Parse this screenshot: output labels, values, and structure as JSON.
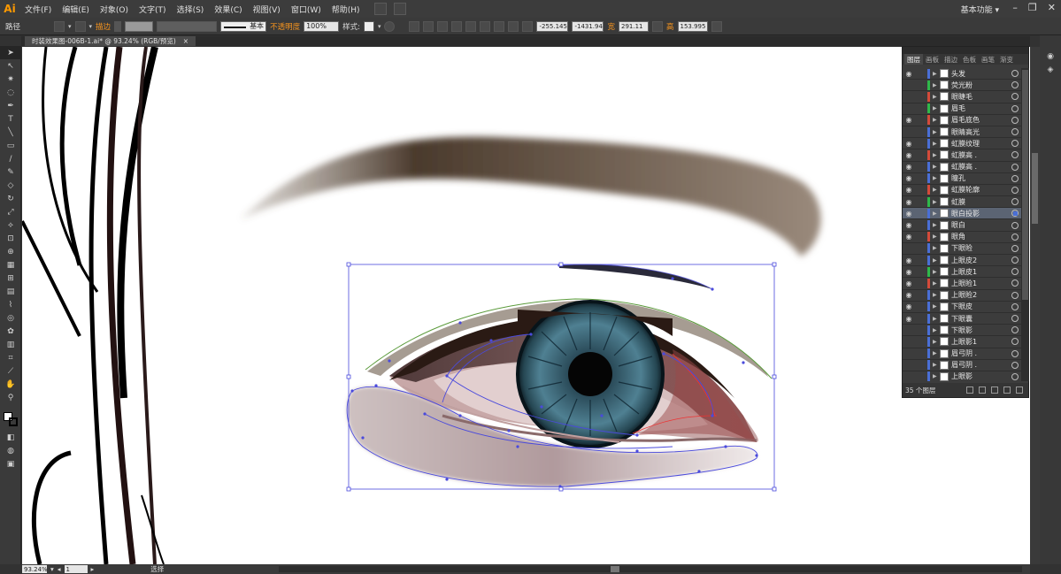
{
  "app": {
    "logo": "Ai",
    "workspace": "基本功能 ▾"
  },
  "menu": [
    "文件(F)",
    "编辑(E)",
    "对象(O)",
    "文字(T)",
    "选择(S)",
    "效果(C)",
    "视图(V)",
    "窗口(W)",
    "帮助(H)"
  ],
  "controlbar": {
    "path_label": "路径",
    "stroke_label": "描边",
    "brush_label": "基本",
    "opacity_label": "不透明度",
    "opacity_value": "100%",
    "style_label": "样式:",
    "x_value": "-255.145",
    "y_value": "-1431.94",
    "w_label": "宽",
    "w_value": "291.11",
    "h_label": "高",
    "h_value": "153.995"
  },
  "document": {
    "tab_title": "时装效果图-006B-1.ai* @ 93.24% (RGB/预览)",
    "close": "×"
  },
  "status": {
    "zoom": "93.24%",
    "page": "1",
    "mode": "选择"
  },
  "layers_panel": {
    "tabs": [
      "图层",
      "画板",
      "描边",
      "色板",
      "画笔",
      "渐变"
    ],
    "count_label": "35 个图层",
    "layers": [
      {
        "name": "头发",
        "eye": true,
        "color": "#4a6fd6"
      },
      {
        "name": "荧光粉",
        "eye": false,
        "color": "#2fb84a"
      },
      {
        "name": "眼睫毛",
        "eye": false,
        "color": "#d44a3a"
      },
      {
        "name": "眉毛",
        "eye": false,
        "color": "#2fb84a"
      },
      {
        "name": "眉毛底色",
        "eye": true,
        "color": "#d44a3a"
      },
      {
        "name": "眼睛高光",
        "eye": false,
        "color": "#4a6fd6"
      },
      {
        "name": "虹膜纹理",
        "eye": true,
        "color": "#4a6fd6"
      },
      {
        "name": "虹膜高 .",
        "eye": true,
        "color": "#d44a3a"
      },
      {
        "name": "虹膜高 .",
        "eye": true,
        "color": "#4a6fd6"
      },
      {
        "name": "瞳孔",
        "eye": true,
        "color": "#4a6fd6"
      },
      {
        "name": "虹膜轮廓",
        "eye": true,
        "color": "#d44a3a"
      },
      {
        "name": "虹膜",
        "eye": true,
        "color": "#2fb84a"
      },
      {
        "name": "眼白投影",
        "eye": true,
        "color": "#4a6fd6",
        "selected": true
      },
      {
        "name": "眼白",
        "eye": true,
        "color": "#4a6fd6"
      },
      {
        "name": "眼角",
        "eye": true,
        "color": "#d44a3a"
      },
      {
        "name": "下眼睑",
        "eye": false,
        "color": "#4a6fd6"
      },
      {
        "name": "上眼皮2",
        "eye": true,
        "color": "#4a6fd6"
      },
      {
        "name": "上眼皮1",
        "eye": true,
        "color": "#2fb84a"
      },
      {
        "name": "上眼睑1",
        "eye": true,
        "color": "#d44a3a"
      },
      {
        "name": "上眼睑2",
        "eye": true,
        "color": "#4a6fd6"
      },
      {
        "name": "下眼皮",
        "eye": true,
        "color": "#4a6fd6"
      },
      {
        "name": "下眼囊",
        "eye": true,
        "color": "#4a6fd6"
      },
      {
        "name": "下眼影",
        "eye": false,
        "color": "#4a6fd6"
      },
      {
        "name": "上眼影1",
        "eye": false,
        "color": "#4a6fd6"
      },
      {
        "name": "眉弓阴 .",
        "eye": false,
        "color": "#4a6fd6"
      },
      {
        "name": "眉弓阴 .",
        "eye": false,
        "color": "#4a6fd6"
      },
      {
        "name": "上眼影",
        "eye": false,
        "color": "#4a6fd6"
      }
    ]
  }
}
